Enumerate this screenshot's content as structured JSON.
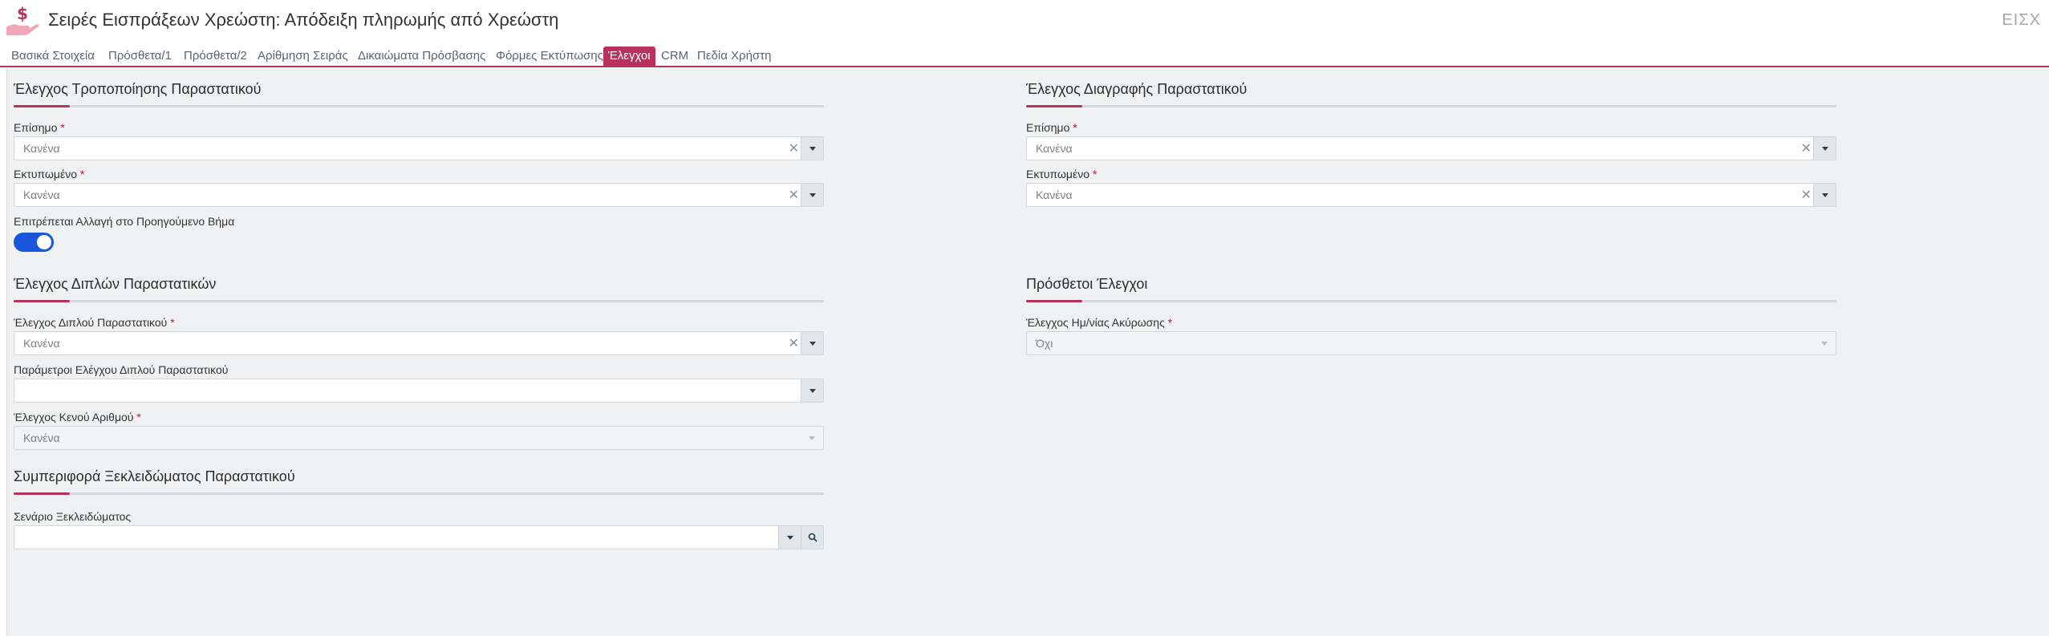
{
  "header": {
    "title": "Σειρές Εισπράξεων Χρεώστη: Απόδειξη πληρωμής από Χρεώστη",
    "code": "ΕΙΣΧ",
    "app_icon": "hand-dollar-icon"
  },
  "tabs": [
    {
      "label": "Βασικά Στοιχεία",
      "active": false
    },
    {
      "label": "Πρόσθετα/1",
      "active": false
    },
    {
      "label": "Πρόσθετα/2",
      "active": false
    },
    {
      "label": "Αρίθμηση Σειράς",
      "active": false
    },
    {
      "label": "Δικαιώματα Πρόσβασης",
      "active": false
    },
    {
      "label": "Φόρμες Εκτύπωσης",
      "active": false
    },
    {
      "label": "Έλεγχοι",
      "active": true
    },
    {
      "label": "CRM",
      "active": false
    },
    {
      "label": "Πεδία Χρήστη",
      "active": false
    }
  ],
  "colors": {
    "accent": "#b8325d",
    "toggle_on": "#1a56db",
    "required": "#c0193b"
  },
  "sections": {
    "modification": {
      "title": "Έλεγχος Τροποποίησης Παραστατικού",
      "official_label": "Επίσημο",
      "official_value": "Κανένα",
      "printed_label": "Εκτυπωμένο",
      "printed_value": "Κανένα",
      "allow_change_label": "Επιτρέπεται Αλλαγή στο Προηγούμενο Βήμα",
      "allow_change_on": true
    },
    "deletion": {
      "title": "Έλεγχος Διαγραφής Παραστατικού",
      "official_label": "Επίσημο",
      "official_value": "Κανένα",
      "printed_label": "Εκτυπωμένο",
      "printed_value": "Κανένα"
    },
    "duplicates": {
      "title": "Έλεγχος Διπλών Παραστατικών",
      "duplicate_check_label": "Έλεγχος Διπλού Παραστατικού",
      "duplicate_check_value": "Κανένα",
      "duplicate_params_label": "Παράμετροι Ελέγχου Διπλού Παραστατικού",
      "duplicate_params_value": "",
      "gap_check_label": "Έλεγχος Κενού Αριθμού",
      "gap_check_value": "Κανένα"
    },
    "additional": {
      "title": "Πρόσθετοι Έλεγχοι",
      "cancel_date_label": "Έλεγχος Ημ/νίας Ακύρωσης",
      "cancel_date_value": "Όχι"
    },
    "unlock": {
      "title": "Συμπεριφορά Ξεκλειδώματος Παραστατικού",
      "scenario_label": "Σενάριο Ξεκλειδώματος",
      "scenario_value": ""
    }
  },
  "required_mark": "*",
  "clear_glyph": "✕"
}
